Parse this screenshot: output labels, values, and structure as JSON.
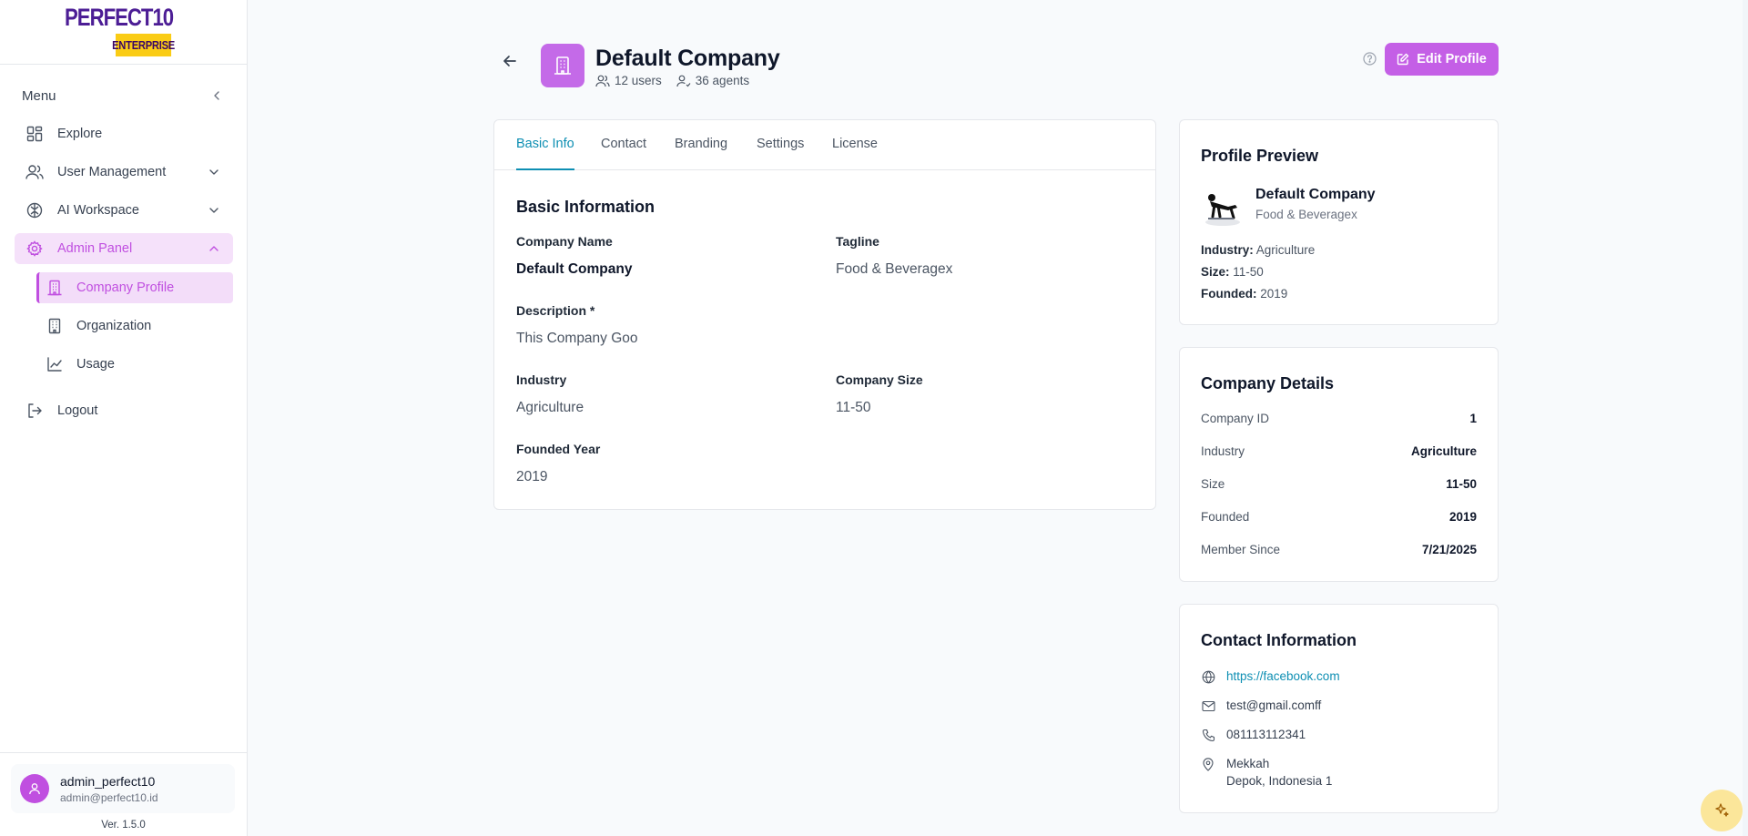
{
  "brand": {
    "logo_main": "PERFECT10",
    "logo_sub": "ENTERPRISE"
  },
  "sidebar": {
    "menu_label": "Menu",
    "items": [
      {
        "label": "Explore"
      },
      {
        "label": "User Management"
      },
      {
        "label": "AI Workspace"
      },
      {
        "label": "Admin Panel"
      }
    ],
    "sub_items": [
      {
        "label": "Company Profile"
      },
      {
        "label": "Organization"
      },
      {
        "label": "Usage"
      }
    ],
    "logout_label": "Logout",
    "user": {
      "name": "admin_perfect10",
      "email": "admin@perfect10.id"
    },
    "version": "Ver. 1.5.0"
  },
  "header": {
    "title": "Default Company",
    "users_count": "12 users",
    "agents_count": "36 agents",
    "edit_label": "Edit Profile"
  },
  "tabs": [
    "Basic Info",
    "Contact",
    "Branding",
    "Settings",
    "License"
  ],
  "basic_info": {
    "section_title": "Basic Information",
    "company_name_label": "Company Name",
    "company_name": "Default Company",
    "tagline_label": "Tagline",
    "tagline": "Food & Beveragex",
    "description_label": "Description *",
    "description": "This Company Goo",
    "industry_label": "Industry",
    "industry": "Agriculture",
    "size_label": "Company Size",
    "size": "11-50",
    "founded_label": "Founded Year",
    "founded": "2019"
  },
  "profile_preview": {
    "title": "Profile Preview",
    "name": "Default Company",
    "tagline": "Food & Beveragex",
    "industry_key": "Industry:",
    "industry": "Agriculture",
    "size_key": "Size:",
    "size": "11-50",
    "founded_key": "Founded:",
    "founded": "2019"
  },
  "company_details": {
    "title": "Company Details",
    "rows": [
      {
        "key": "Company ID",
        "value": "1"
      },
      {
        "key": "Industry",
        "value": "Agriculture"
      },
      {
        "key": "Size",
        "value": "11-50"
      },
      {
        "key": "Founded",
        "value": "2019"
      },
      {
        "key": "Member Since",
        "value": "7/21/2025"
      }
    ]
  },
  "contact_info": {
    "title": "Contact Information",
    "website": "https://facebook.com",
    "email": "test@gmail.comff",
    "phone": "081113112341",
    "address_line1": "Mekkah",
    "address_line2": "Depok, Indonesia 1"
  },
  "colors": {
    "accent": "#c04fe0",
    "link": "#0e8fb3",
    "brand_purple": "#4c1d95",
    "brand_yellow": "#facc15"
  }
}
